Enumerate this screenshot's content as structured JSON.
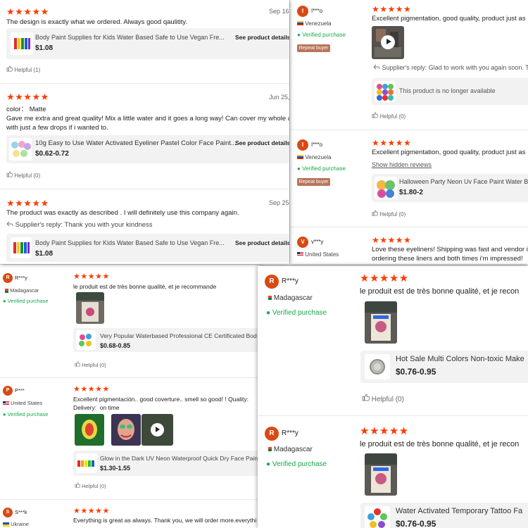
{
  "stars": "★★★★★",
  "panel1": {
    "reviews": [
      {
        "date": "Sep 16,",
        "text": "The design is exactly what we ordered. Always good qaulitity.",
        "product_title": "Body Paint Supplies for Kids Water Based Safe to Use Vegan Fre...",
        "price": "$1.08",
        "see": "See product details",
        "helpful": "Helpful (1)"
      },
      {
        "date": "Jun 25,",
        "color": "color： Matte",
        "text1": "Gave me extra and great quality! Mix a little water and it goes a long way! Can cover my whole ar",
        "text2": "with just a few drops if i wanted to.",
        "product_title": "10g Easy to Use Water Activated Eyeliner Pastel Color Face Paint...",
        "price": "$0.62-0.72",
        "see": "See product details",
        "helpful": "Helpful (0)"
      },
      {
        "date": "Sep 25,",
        "text": "The product was exactly as described . I will definitely use this company again.",
        "reply": "Supplier's reply: Thank you with your kindness",
        "product_title": "Body Paint Supplies for Kids Water Based Safe to Use Vegan Fre...",
        "price": "$1.08",
        "see": "See product details"
      }
    ]
  },
  "panel2": {
    "reviews": [
      {
        "initial": "I",
        "name": "I***o",
        "country": "Venezuela",
        "verified": "Verified purchase",
        "badge": "Repeat buyer",
        "text": "Excellent pigmentation, good quality, product just as I",
        "reply": "Supplier's reply: Glad to work with you again soon. T",
        "unavailable": "This product is no longer available",
        "helpful": "Helpful (0)"
      },
      {
        "initial": "I",
        "name": "I***o",
        "country": "Venezuela",
        "verified": "Verified purchase",
        "badge": "Repeat buyer",
        "text": "Excellent pigmentation, good quality, product just as I",
        "hidden": "Show hidden reviews",
        "product_title": "Halloween Party Neon Uv Face Paint Water B",
        "price": "$1.80-2",
        "helpful": "Helpful (0)"
      },
      {
        "initial": "V",
        "name": "v***y",
        "country": "United States",
        "text1": "Love these eyeliners! Shipping was fast and vendor is g",
        "text2": "ordering these liners and both times i'm impressed!"
      }
    ]
  },
  "panel3": {
    "reviews": [
      {
        "initial": "R",
        "name": "R***y",
        "country": "Madagascar",
        "verified": "Verified purchase",
        "text": "le produit est de très bonne qualité, et je recommande",
        "product_title": "Very Popular Waterbased Professional CE Certificated Bod",
        "price": "$0.68-0.85",
        "helpful": "Helpful (0)"
      },
      {
        "initial": "P",
        "name": "P***",
        "country": "United States",
        "verified": "Verified purchase",
        "text1": "Excellent pigmentación.. good coverture.. smell so good! ! Quality:",
        "text2": "Delivery:  on time",
        "product_title": "Glow in the Dark UV Neon Waterproof Quick Dry Face Pain",
        "price": "$1.30-1.55",
        "helpful": "Helpful (0)"
      },
      {
        "initial": "S",
        "name": "S***k",
        "country": "Ukraine",
        "text": "Everything is great as always. Thank you, we will order more.everythi"
      }
    ]
  },
  "panel4": {
    "reviews": [
      {
        "initial": "R",
        "name": "R***y",
        "country": "Madagascar",
        "verified": "Verified purchase",
        "text": "le produit est de très bonne qualité, et je recon",
        "product_title": "Hot Sale Multi Colors Non-toxic Make",
        "price": "$0.76-0.95",
        "helpful": "Helpful (0)"
      },
      {
        "initial": "R",
        "name": "R***y",
        "country": "Madagascar",
        "verified": "Verified purchase",
        "text": "le produit est de très bonne qualité, et je recon",
        "product_title": "Water Activated Temporary Tattoo Fa",
        "price": "$0.76-0.95"
      }
    ]
  },
  "icons": {
    "thumb": "thumbs-up-icon",
    "reply": "reply-arrow-icon",
    "check": "check-circle-icon",
    "play": "play-icon"
  },
  "colors": {
    "star": "#fd3c00",
    "avatar": "#d84a14",
    "verified": "#18a84a",
    "repeat_badge": "#b8745a"
  }
}
